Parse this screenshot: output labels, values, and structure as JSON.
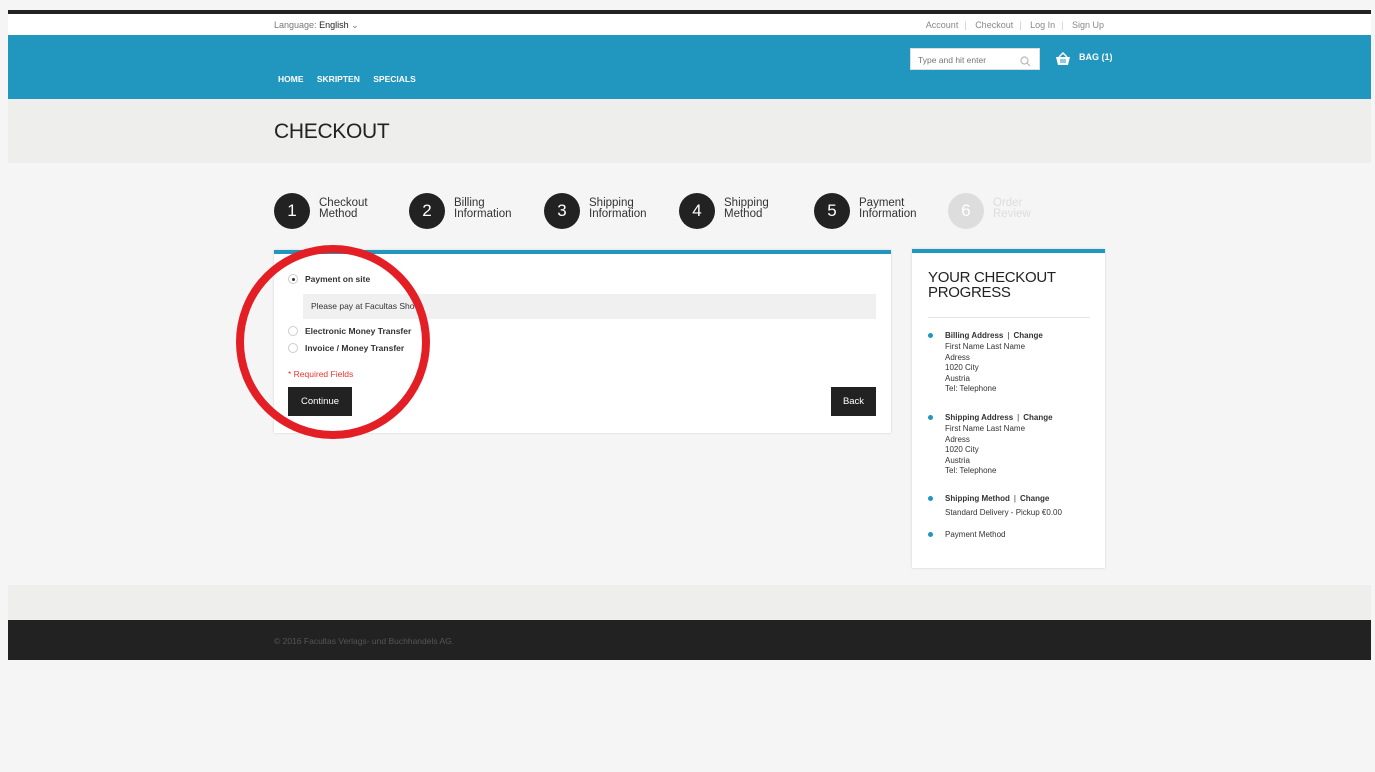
{
  "topbar": {
    "language_label": "Language:",
    "language_value": "English",
    "links": [
      "Account",
      "Checkout",
      "Log In",
      "Sign Up"
    ]
  },
  "header": {
    "nav": [
      "HOME",
      "SKRIPTEN",
      "SPECIALS"
    ],
    "search_placeholder": "Type and hit enter",
    "bag_label": "BAG (1)",
    "accent_color": "#2196be"
  },
  "page": {
    "title": "CHECKOUT"
  },
  "steps": [
    {
      "num": "1",
      "line1": "Checkout",
      "line2": "Method"
    },
    {
      "num": "2",
      "line1": "Billing",
      "line2": "Information"
    },
    {
      "num": "3",
      "line1": "Shipping",
      "line2": "Information"
    },
    {
      "num": "4",
      "line1": "Shipping",
      "line2": "Method"
    },
    {
      "num": "5",
      "line1": "Payment",
      "line2": "Information"
    },
    {
      "num": "6",
      "line1": "Order",
      "line2": "Review"
    }
  ],
  "payment": {
    "options": [
      "Payment on site",
      "Electronic Money Transfer",
      "Invoice / Money Transfer"
    ],
    "selected": "Payment on site",
    "note": "Please pay at Facultas Sho",
    "required": "* Required Fields",
    "continue_label": "Continue",
    "back_label": "Back"
  },
  "progress": {
    "title": "YOUR CHECKOUT PROGRESS",
    "change_label": "Change",
    "billing": {
      "label": "Billing Address",
      "lines": [
        "First Name Last Name",
        "Adress",
        "1020 City",
        "Austria",
        "Tel: Telephone"
      ]
    },
    "shipping": {
      "label": "Shipping Address",
      "lines": [
        "First Name Last Name",
        "Adress",
        "1020 City",
        "Austria",
        "Tel: Telephone"
      ]
    },
    "shipping_method": {
      "label": "Shipping Method",
      "value": "Standard Delivery - Pickup €0.00"
    },
    "payment_method": {
      "label": "Payment Method"
    }
  },
  "footer": {
    "copyright": "© 2016 Facultas Verlags- und Buchhandels AG."
  },
  "annotation": {
    "highlight_color": "#e31e24"
  }
}
